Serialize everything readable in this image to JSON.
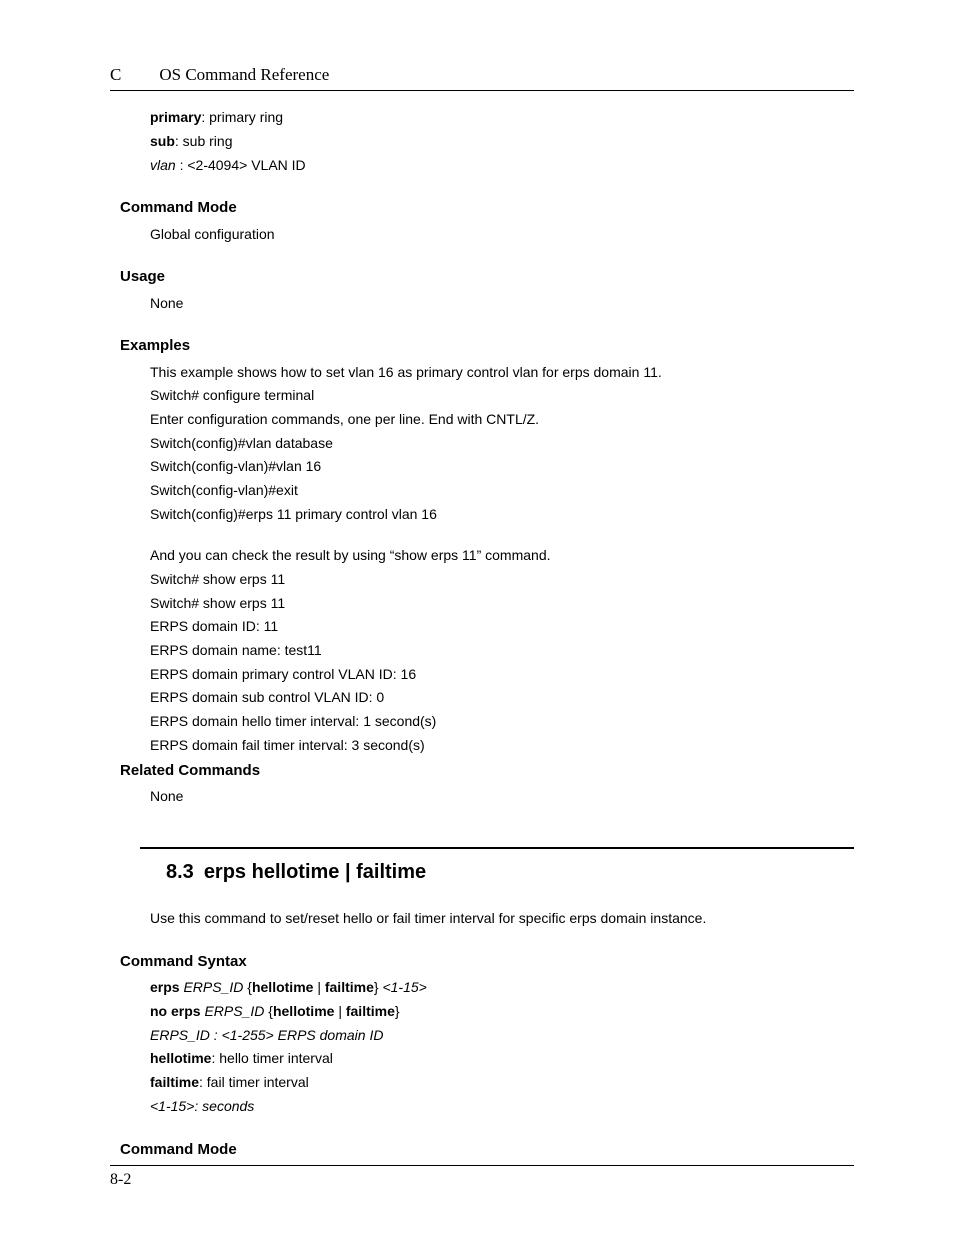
{
  "header": {
    "letter": "C",
    "title": "OS Command Reference"
  },
  "top_params": [
    {
      "term": "primary",
      "desc": ": primary ring",
      "term_bold": true
    },
    {
      "term": "sub",
      "desc": ": sub ring",
      "term_bold": true
    },
    {
      "term": "vlan ",
      "desc": ": <2-4094> VLAN   ID",
      "term_italic": true
    }
  ],
  "sections": {
    "command_mode_1": {
      "title": "Command Mode",
      "body": [
        "Global configuration"
      ]
    },
    "usage": {
      "title": "Usage",
      "body": [
        "None"
      ]
    },
    "examples": {
      "title": "Examples",
      "body1": [
        "This example shows how to set vlan 16 as primary control vlan for erps domain 11.",
        "Switch# configure terminal",
        "Enter configuration commands, one per line.   End with CNTL/Z.",
        "Switch(config)#vlan database",
        "Switch(config-vlan)#vlan 16",
        "Switch(config-vlan)#exit",
        "Switch(config)#erps 11 primary control vlan 16"
      ],
      "body2": [
        "And you can check the result by using “show erps 11” command.",
        "Switch# show erps 11",
        "Switch# show erps 11",
        "ERPS domain ID: 11",
        "ERPS domain name: test11",
        "ERPS domain primary control VLAN ID: 16",
        "ERPS domain sub control VLAN ID: 0",
        "ERPS domain hello timer interval: 1 second(s)",
        "ERPS domain fail timer interval: 3 second(s)"
      ]
    },
    "related": {
      "title": "Related Commands",
      "body": [
        "None"
      ]
    },
    "section83": {
      "num": "8.3",
      "title": "erps hellotime | failtime",
      "desc": "Use this command to set/reset hello or fail timer interval for specific erps domain instance."
    },
    "syntax": {
      "title": "Command Syntax",
      "lines": {
        "l1_a": "erps ",
        "l1_b": "ERPS_ID ",
        "l1_c": "{",
        "l1_d": "hellotime ",
        "l1_e": "| ",
        "l1_f": "failtime",
        "l1_g": "} ",
        "l1_h": "<1-15>",
        "l2_a": "no erps ",
        "l2_b": "ERPS_ID ",
        "l2_c": "{",
        "l2_d": "hellotime ",
        "l2_e": "| ",
        "l2_f": "failtime",
        "l2_g": "}",
        "l3": "ERPS_ID : <1-255> ERPS domain ID",
        "l4_a": "hellotime",
        "l4_b": ": hello timer interval",
        "l5_a": "failtime",
        "l5_b": ": fail timer interval",
        "l6": "<1-15>: seconds"
      }
    },
    "command_mode_2": {
      "title": "Command Mode"
    }
  },
  "footer": {
    "page": "8-2"
  }
}
